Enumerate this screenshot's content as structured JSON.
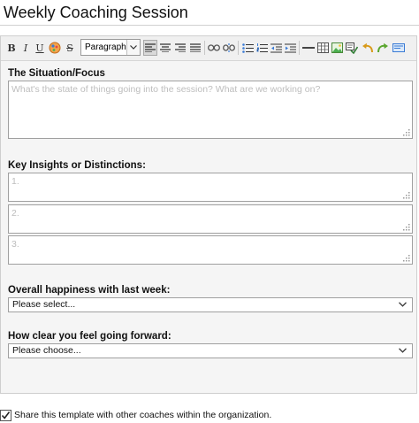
{
  "window": {
    "title": "Weekly Coaching Session"
  },
  "toolbar": {
    "format_value": "Paragraph",
    "buttons": [
      "bold",
      "italic",
      "underline",
      "text-color",
      "strikethrough",
      "align-left",
      "align-center",
      "align-right",
      "align-justify",
      "link",
      "unlink",
      "bullet-list",
      "numbered-list",
      "outdent",
      "indent",
      "horizontal-rule",
      "table",
      "image",
      "insert-template",
      "undo",
      "redo",
      "spellcheck"
    ]
  },
  "form": {
    "situation": {
      "label": "The Situation/Focus",
      "placeholder": "What's the state of things going into the session?  What are we working on?"
    },
    "insights": {
      "label": "Key Insights or Distinctions:",
      "items": [
        {
          "placeholder": "1."
        },
        {
          "placeholder": "2."
        },
        {
          "placeholder": "3."
        }
      ]
    },
    "happiness": {
      "label": "Overall happiness with last week:",
      "selected": "Please select..."
    },
    "clarity": {
      "label": "How clear you feel going forward:",
      "selected": "Please choose..."
    }
  },
  "share": {
    "checked": true,
    "label": "Share this template with other coaches within the organization."
  }
}
